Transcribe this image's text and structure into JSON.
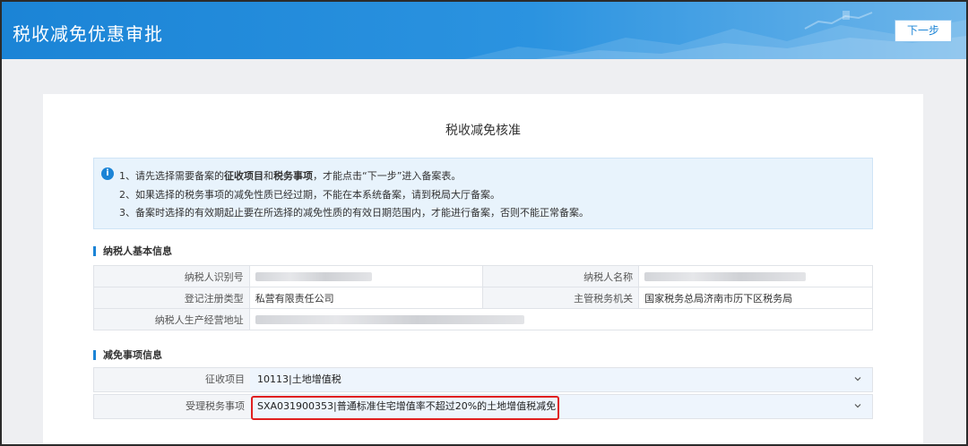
{
  "header": {
    "title": "税收减免优惠审批",
    "next_label": "下一步"
  },
  "card": {
    "title": "税收减免核准"
  },
  "notice": {
    "line1_a": "1、请先选择需要备案的",
    "line1_b": "征收项目",
    "line1_c": "和",
    "line1_d": "税务事项",
    "line1_e": "，才能点击“下一步”进入备案表。",
    "line2": "2、如果选择的税务事项的减免性质已经过期，不能在本系统备案，请到税局大厅备案。",
    "line3": "3、备案时选择的有效期起止要在所选择的减免性质的有效日期范围内，才能进行备案，否则不能正常备案。"
  },
  "taxpayer": {
    "section_title": "纳税人基本信息",
    "id_label": "纳税人识别号",
    "name_label": "纳税人名称",
    "reg_type_label": "登记注册类型",
    "reg_type_value": "私营有限责任公司",
    "authority_label": "主管税务机关",
    "authority_value": "国家税务总局济南市历下区税务局",
    "address_label": "纳税人生产经营地址"
  },
  "relief": {
    "section_title": "减免事项信息",
    "levy_label": "征收项目",
    "levy_value": "10113|土地增值税",
    "matter_label": "受理税务事项",
    "matter_value": "SXA031900353|普通标准住宅增值率不超过20%的土地增值税减免"
  }
}
